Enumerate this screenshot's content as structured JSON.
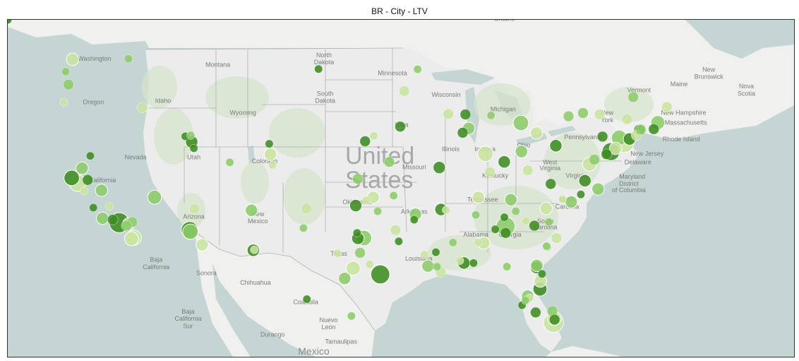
{
  "title": "BR - City - LTV",
  "colors": {
    "water": "#c5d5d4",
    "land_us": "#ececec",
    "land_other": "#f0f0ee",
    "vegetation": "#d6e4cc",
    "border": "#b0b0b0",
    "bubble_light": "#c9e4a0",
    "bubble_mid": "#8ccc6a",
    "bubble_dark": "#3d8c21",
    "bubble_stroke": "#ffffff"
  },
  "map": {
    "country_label": "United States",
    "country_label_line1": "United",
    "country_label_line2": "States",
    "region_labels": [
      {
        "text": "Ontario",
        "lon": -84.5,
        "lat": 50.8
      },
      {
        "text": "Washington",
        "lon": -120.4,
        "lat": 47.5
      },
      {
        "text": "Montana",
        "lon": -109.6,
        "lat": 47.0
      },
      {
        "text": "North",
        "lon": -100.3,
        "lat": 47.8
      },
      {
        "text": "Dakota",
        "lon": -100.3,
        "lat": 47.2
      },
      {
        "text": "Minnesota",
        "lon": -94.3,
        "lat": 46.3
      },
      {
        "text": "South",
        "lon": -100.2,
        "lat": 44.6
      },
      {
        "text": "Dakota",
        "lon": -100.2,
        "lat": 44.0
      },
      {
        "text": "Wisconsin",
        "lon": -89.6,
        "lat": 44.5
      },
      {
        "text": "Oregon",
        "lon": -120.5,
        "lat": 43.9
      },
      {
        "text": "Idaho",
        "lon": -114.4,
        "lat": 44.0
      },
      {
        "text": "Wyoming",
        "lon": -107.4,
        "lat": 43.0
      },
      {
        "text": "Michigan",
        "lon": -84.6,
        "lat": 43.3
      },
      {
        "text": "Iowa",
        "lon": -93.5,
        "lat": 42.0
      },
      {
        "text": "Nevada",
        "lon": -116.8,
        "lat": 39.3
      },
      {
        "text": "Utah",
        "lon": -111.7,
        "lat": 39.3
      },
      {
        "text": "Colorado",
        "lon": -105.5,
        "lat": 39.0
      },
      {
        "text": "Illinois",
        "lon": -89.2,
        "lat": 40.0
      },
      {
        "text": "Indiana",
        "lon": -86.2,
        "lat": 40.0
      },
      {
        "text": "Ohio",
        "lon": -82.8,
        "lat": 40.3
      },
      {
        "text": "Pennsylvania",
        "lon": -77.6,
        "lat": 41.0
      },
      {
        "text": "New",
        "lon": -75.5,
        "lat": 43.0
      },
      {
        "text": "York",
        "lon": -75.5,
        "lat": 42.4
      },
      {
        "text": "Vermont",
        "lon": -72.7,
        "lat": 44.9
      },
      {
        "text": "Maine",
        "lon": -69.2,
        "lat": 45.4
      },
      {
        "text": "New",
        "lon": -66.6,
        "lat": 46.6
      },
      {
        "text": "Brunswick",
        "lon": -66.6,
        "lat": 46.0
      },
      {
        "text": "Nova",
        "lon": -63.3,
        "lat": 45.2
      },
      {
        "text": "Scotia",
        "lon": -63.3,
        "lat": 44.6
      },
      {
        "text": "New Hampshire",
        "lon": -68.8,
        "lat": 43.0
      },
      {
        "text": "Massachusetts",
        "lon": -68.6,
        "lat": 42.2
      },
      {
        "text": "Rhode Island",
        "lon": -69.0,
        "lat": 40.8
      },
      {
        "text": "New Jersey",
        "lon": -72.0,
        "lat": 39.6
      },
      {
        "text": "Delaware",
        "lon": -72.8,
        "lat": 38.9
      },
      {
        "text": "Maryland",
        "lon": -73.3,
        "lat": 37.7
      },
      {
        "text": "District",
        "lon": -73.6,
        "lat": 37.1
      },
      {
        "text": "of Columbia",
        "lon": -73.6,
        "lat": 36.6
      },
      {
        "text": "West",
        "lon": -80.5,
        "lat": 38.9
      },
      {
        "text": "Virginia",
        "lon": -80.5,
        "lat": 38.4
      },
      {
        "text": "Virginia",
        "lon": -78.2,
        "lat": 37.8
      },
      {
        "text": "Kentucky",
        "lon": -85.3,
        "lat": 37.8
      },
      {
        "text": "Missouri",
        "lon": -92.4,
        "lat": 38.5
      },
      {
        "text": "California",
        "lon": -119.7,
        "lat": 37.4
      },
      {
        "text": "Arizona",
        "lon": -111.7,
        "lat": 34.4
      },
      {
        "text": "New",
        "lon": -106.1,
        "lat": 34.6
      },
      {
        "text": "Mexico",
        "lon": -106.1,
        "lat": 34.0
      },
      {
        "text": "Oklahoma",
        "lon": -97.4,
        "lat": 35.6
      },
      {
        "text": "Arkansas",
        "lon": -92.4,
        "lat": 34.8
      },
      {
        "text": "Tennessee",
        "lon": -86.4,
        "lat": 35.8
      },
      {
        "text": "North",
        "lon": -79.0,
        "lat": 35.8
      },
      {
        "text": "Carolina",
        "lon": -79.0,
        "lat": 35.2
      },
      {
        "text": "South",
        "lon": -80.9,
        "lat": 34.0
      },
      {
        "text": "Carolina",
        "lon": -80.9,
        "lat": 33.5
      },
      {
        "text": "Alabama",
        "lon": -87.0,
        "lat": 32.9
      },
      {
        "text": "Georgia",
        "lon": -84.0,
        "lat": 32.9
      },
      {
        "text": "Texas",
        "lon": -99.0,
        "lat": 31.3
      },
      {
        "text": "Louisiana",
        "lon": -92.0,
        "lat": 30.9
      },
      {
        "text": "Baja",
        "lon": -115.0,
        "lat": 30.8
      },
      {
        "text": "California",
        "lon": -115.0,
        "lat": 30.2
      },
      {
        "text": "Sonora",
        "lon": -110.6,
        "lat": 29.7
      },
      {
        "text": "Chihuahua",
        "lon": -106.3,
        "lat": 28.9
      },
      {
        "text": "Coahuila",
        "lon": -101.9,
        "lat": 27.3
      },
      {
        "text": "Baja",
        "lon": -112.2,
        "lat": 26.5
      },
      {
        "text": "California",
        "lon": -112.2,
        "lat": 25.9
      },
      {
        "text": "Sur",
        "lon": -112.2,
        "lat": 25.3
      },
      {
        "text": "Nuevo",
        "lon": -99.9,
        "lat": 25.8
      },
      {
        "text": "León",
        "lon": -99.9,
        "lat": 25.2
      },
      {
        "text": "Durango",
        "lon": -104.8,
        "lat": 24.6
      },
      {
        "text": "Tamaulipas",
        "lon": -98.8,
        "lat": 24.0
      },
      {
        "text": "Mexico",
        "lon": -101.2,
        "lat": 23.1
      }
    ]
  },
  "chart_data": {
    "type": "scatter",
    "title": "BR - City - LTV",
    "encoding": "bubble map: x = longitude, y = latitude, size and shade = relative LTV (1-10)",
    "xlim": [
      -128.0,
      -59.0
    ],
    "ylim": [
      22.8,
      50.9
    ],
    "x": [
      -122.33,
      -122.68,
      -122.4,
      -121.89,
      -121.49,
      -118.24,
      -117.16,
      -119.79,
      -112.07,
      -110.97,
      -115.14,
      -111.89,
      -104.99,
      -106.65,
      -97.52,
      -95.99,
      -96.8,
      -97.33,
      -97.74,
      -98.49,
      -95.37,
      -90.07,
      -92.29,
      -90.05,
      -86.78,
      -84.39,
      -81.69,
      -80.19,
      -82.46,
      -81.38,
      -80.84,
      -78.64,
      -77.44,
      -77.04,
      -76.61,
      -75.17,
      -74.01,
      -71.06,
      -72.68,
      -73.76,
      -78.88,
      -79.99,
      -81.69,
      -83.05,
      -84.51,
      -86.16,
      -87.63,
      -87.91,
      -93.27,
      -94.58,
      -90.2,
      -85.76,
      -83.0,
      -84.39,
      -80.13,
      -81.66,
      -81.76,
      -117.4,
      -119.7,
      -121.0,
      -116.97,
      -112.0,
      -106.49,
      -101.84,
      -97.14,
      -96.7,
      -94.04,
      -91.19,
      -88.04,
      -86.31,
      -83.93,
      -81.87,
      -79.93,
      -76.29,
      -75.55,
      -74.75,
      -74.45,
      -73.54,
      -72.93,
      -72.55,
      -71.41,
      -70.26,
      -73.21,
      -75.9,
      -76.15,
      -77.61,
      -80.44,
      -82.45,
      -85.67,
      -88.15,
      -89.4,
      -92.1,
      -93.62,
      -95.94,
      -97.34,
      -100.78,
      -104.82,
      -108.55,
      -111.7,
      -116.2,
      -117.43,
      -120.77,
      -123.09,
      -122.93,
      -112.45,
      -111.65,
      -117.1,
      -118.8,
      -119.1,
      -117.6,
      -120.5,
      -121.3,
      -111.97,
      -105.1,
      -96.6,
      -94.2,
      -92.4,
      -89.6,
      -87.0,
      -84.5,
      -82.6,
      -80.6,
      -82.95,
      -82.3,
      -80.3,
      -80.1,
      -81.35,
      -82.65,
      -81.2,
      -80.7,
      -84.28,
      -87.2,
      -88.4,
      -90.4,
      -93.75,
      -96.3,
      -97.9,
      -101.8,
      -106.4,
      -80.8,
      -77.8,
      -79.4,
      -83.5,
      -85.3,
      -86.8,
      -89.0,
      -90.5,
      -91.5,
      -95.6,
      -97.4,
      -99.1,
      -102.1
    ],
    "y": [
      47.61,
      45.52,
      37.77,
      37.34,
      38.58,
      34.05,
      32.72,
      36.74,
      33.45,
      32.22,
      36.17,
      40.76,
      39.74,
      35.08,
      35.47,
      36.15,
      32.78,
      32.75,
      30.27,
      29.42,
      29.76,
      29.95,
      34.75,
      35.15,
      36.16,
      33.75,
      30.33,
      25.76,
      27.95,
      28.54,
      35.23,
      35.78,
      37.54,
      38.91,
      39.29,
      39.95,
      40.71,
      42.36,
      41.76,
      42.65,
      42.89,
      40.44,
      41.5,
      42.33,
      39.1,
      39.77,
      41.88,
      43.04,
      44.98,
      39.1,
      38.63,
      38.25,
      39.96,
      33.2,
      26.1,
      30.5,
      26.6,
      33.95,
      34.42,
      37.6,
      32.8,
      33.3,
      31.76,
      35.22,
      31.55,
      40.81,
      33.43,
      30.45,
      30.7,
      32.37,
      35.96,
      33.8,
      32.78,
      36.85,
      39.74,
      40.22,
      41.1,
      41.0,
      41.31,
      41.78,
      41.82,
      43.66,
      44.48,
      41.2,
      43.05,
      43.16,
      37.27,
      38.4,
      42.96,
      41.52,
      43.07,
      46.79,
      42.03,
      41.26,
      37.69,
      46.81,
      38.83,
      39.06,
      40.23,
      43.62,
      47.66,
      39.6,
      44.05,
      46.6,
      41.22,
      35.2,
      34.1,
      34.3,
      35.4,
      33.8,
      35.3,
      36.7,
      41.3,
      40.6,
      35.9,
      36.3,
      34.3,
      35.1,
      34.7,
      34.5,
      34.2,
      34.1,
      27.2,
      27.8,
      26.7,
      26.0,
      29.2,
      27.6,
      29.8,
      32.0,
      30.4,
      30.7,
      30.9,
      30.4,
      32.5,
      30.6,
      26.3,
      27.7,
      31.8,
      32.1,
      36.4,
      36.0,
      35.0,
      33.5,
      32.4,
      32.4,
      31.6,
      31.4,
      35.0,
      33.2,
      31.5,
      33.6
    ],
    "values": [
      3,
      2,
      5,
      6,
      3,
      9,
      4,
      3,
      6,
      3,
      4,
      3,
      3,
      3,
      3,
      3,
      5,
      3,
      4,
      3,
      8,
      2,
      3,
      3,
      3,
      8,
      3,
      9,
      3,
      4,
      3,
      3,
      3,
      4,
      2,
      7,
      9,
      4,
      2,
      2,
      2,
      3,
      3,
      5,
      3,
      5,
      3,
      2,
      2,
      2,
      3,
      2,
      3,
      2,
      4,
      3,
      2,
      3,
      3,
      2,
      5,
      5,
      3,
      2,
      2,
      2,
      2,
      3,
      3,
      3,
      3,
      2,
      2,
      3,
      2,
      3,
      5,
      3,
      2,
      2,
      2,
      2,
      2,
      2,
      2,
      2,
      2,
      2,
      1,
      2,
      2,
      1,
      2,
      1,
      2,
      1,
      1,
      1,
      1,
      2,
      1,
      1,
      1,
      1,
      1,
      2,
      2,
      2,
      1,
      2,
      1,
      1,
      1,
      1,
      1,
      1,
      1,
      1,
      1,
      1,
      1,
      1,
      1,
      1,
      2,
      2,
      3,
      1,
      1,
      1,
      1,
      1,
      1,
      1,
      1,
      1,
      1,
      1,
      1,
      1,
      1,
      1,
      1,
      1,
      1,
      1,
      1,
      1,
      1,
      1,
      1,
      1,
      1,
      1,
      1,
      1
    ]
  }
}
